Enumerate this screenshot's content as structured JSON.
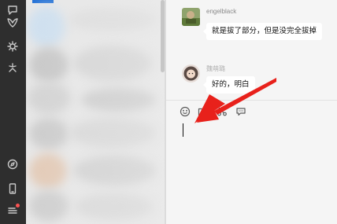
{
  "nav": {
    "items": [
      "chat-icon",
      "contacts-icon",
      "favorites-icon",
      "moments-icon",
      "miniprogram-icon",
      "phone-icon",
      "menu-icon"
    ],
    "badge_color": "#fa5151"
  },
  "chat": {
    "messages": [
      {
        "sender": "engelblack",
        "text": "就是拔了部分，但是没完全拔掉"
      },
      {
        "sender": "魏萌璐",
        "text": "好的，明白"
      }
    ],
    "toolbar": [
      "emoji-icon",
      "folder-icon",
      "scissors-icon",
      "chat-history-icon"
    ]
  },
  "colors": {
    "rail": "#2e2e2e",
    "accent": "#1f6fd6",
    "arrow": "#e8211b",
    "bubble": "#ffffff"
  }
}
